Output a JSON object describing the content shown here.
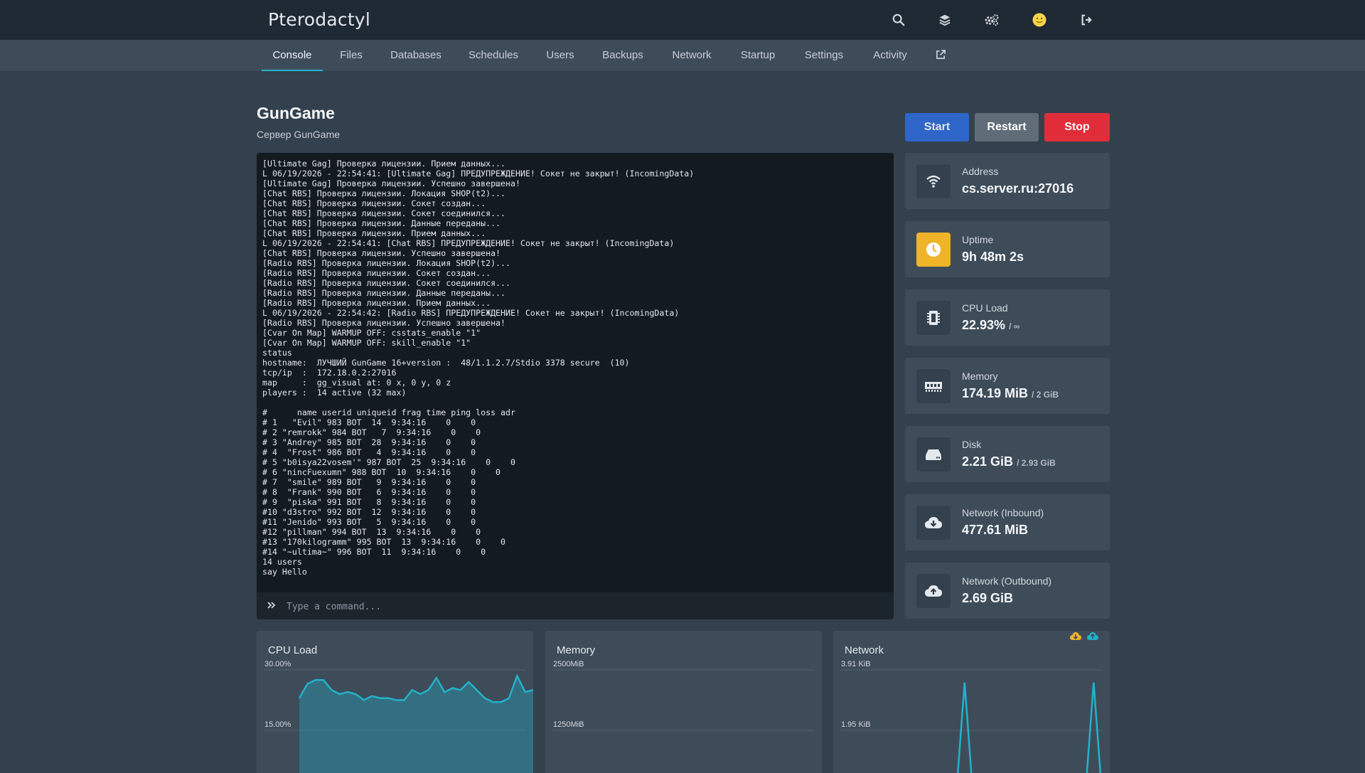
{
  "app": {
    "brand": "Pterodactyl"
  },
  "topbar": {
    "icons": [
      "search-icon",
      "layers-icon",
      "cogs-icon",
      "avatar",
      "sign-out-icon"
    ]
  },
  "tabs": [
    {
      "label": "Console",
      "active": true
    },
    {
      "label": "Files"
    },
    {
      "label": "Databases"
    },
    {
      "label": "Schedules"
    },
    {
      "label": "Users"
    },
    {
      "label": "Backups"
    },
    {
      "label": "Network"
    },
    {
      "label": "Startup"
    },
    {
      "label": "Settings"
    },
    {
      "label": "Activity"
    }
  ],
  "server": {
    "name": "GunGame",
    "description": "Сервер GunGame"
  },
  "power": {
    "start": "Start",
    "restart": "Restart",
    "stop": "Stop"
  },
  "console": {
    "lines": [
      "[Ultimate Gag] Проверка лицензии. Прием данных...",
      "L 06/19/2026 - 22:54:41: [Ultimate Gag] ПРЕДУПРЕЖДЕНИЕ! Сокет не закрыт! (IncomingData)",
      "[Ultimate Gag] Проверка лицензии. Успешно завершена!",
      "[Chat RBS] Проверка лицензии. Локация SHOP(t2)...",
      "[Chat RBS] Проверка лицензии. Сокет создан...",
      "[Chat RBS] Проверка лицензии. Сокет соединился...",
      "[Chat RBS] Проверка лицензии. Данные переданы...",
      "[Chat RBS] Проверка лицензии. Прием данных...",
      "L 06/19/2026 - 22:54:41: [Chat RBS] ПРЕДУПРЕЖДЕНИЕ! Сокет не закрыт! (IncomingData)",
      "[Chat RBS] Проверка лицензии. Успешно завершена!",
      "[Radio RBS] Проверка лицензии. Локация SHOP(t2)...",
      "[Radio RBS] Проверка лицензии. Сокет создан...",
      "[Radio RBS] Проверка лицензии. Сокет соединился...",
      "[Radio RBS] Проверка лицензии. Данные переданы...",
      "[Radio RBS] Проверка лицензии. Прием данных...",
      "L 06/19/2026 - 22:54:42: [Radio RBS] ПРЕДУПРЕЖДЕНИЕ! Сокет не закрыт! (IncomingData)",
      "[Radio RBS] Проверка лицензии. Успешно завершена!",
      "[Cvar On Map] WARMUP OFF: csstats_enable \"1\"",
      "[Cvar On Map] WARMUP OFF: skill_enable \"1\"",
      "status",
      "hostname:  ЛУЧШИЙ GunGame 16+version :  48/1.1.2.7/Stdio 3378 secure  (10)",
      "tcp/ip  :  172.18.0.2:27016",
      "map     :  gg_visual at: 0 x, 0 y, 0 z",
      "players :  14 active (32 max)",
      "",
      "#      name userid uniqueid frag time ping loss adr",
      "# 1   \"Evil\" 983 BOT  14  9:34:16    0    0",
      "# 2 \"remrokk\" 984 BOT   7  9:34:16    0    0",
      "# 3 \"Andrey\" 985 BOT  28  9:34:16    0    0",
      "# 4  \"Frost\" 986 BOT   4  9:34:16    0    0",
      "# 5 \"b0isya22vosem'\" 987 BOT  25  9:34:16    0    0",
      "# 6 \"nincFuexumn\" 988 BOT  10  9:34:16    0    0",
      "# 7  \"smile\" 989 BOT   9  9:34:16    0    0",
      "# 8  \"Frank\" 990 BOT   6  9:34:16    0    0",
      "# 9  \"piska\" 991 BOT   8  9:34:16    0    0",
      "#10 \"d3stro\" 992 BOT  12  9:34:16    0    0",
      "#11 \"Jenido\" 993 BOT   5  9:34:16    0    0",
      "#12 \"pillman\" 994 BOT  13  9:34:16    0    0",
      "#13 \"170kilogramm\" 995 BOT  13  9:34:16    0    0",
      "#14 \"~ultima~\" 996 BOT  11  9:34:16    0    0",
      "14 users",
      "say Hello"
    ],
    "command_placeholder": "Type a command..."
  },
  "stats": [
    {
      "label": "Address",
      "value": "cs.server.ru:27016",
      "sub": "",
      "icon": "wifi-icon"
    },
    {
      "label": "Uptime",
      "value": "9h 48m 2s",
      "sub": "",
      "icon": "clock-icon",
      "highlight": "#f0b429"
    },
    {
      "label": "CPU Load",
      "value": "22.93%",
      "sub": "/ ∞",
      "icon": "microchip-icon"
    },
    {
      "label": "Memory",
      "value": "174.19 MiB",
      "sub": "/ 2 GiB",
      "icon": "memory-icon"
    },
    {
      "label": "Disk",
      "value": "2.21 GiB",
      "sub": "/ 2.93 GiB",
      "icon": "hdd-icon"
    },
    {
      "label": "Network (Inbound)",
      "value": "477.61 MiB",
      "sub": "",
      "icon": "cloud-download-icon"
    },
    {
      "label": "Network (Outbound)",
      "value": "2.69 GiB",
      "sub": "",
      "icon": "cloud-upload-icon"
    }
  ],
  "colors": {
    "accent": "#22b2cb",
    "start": "#2d6cdf",
    "restart": "#606c78",
    "stop": "#e12d39",
    "inbound": "#f0b429",
    "outbound": "#22b2cb"
  },
  "chart_data": [
    {
      "type": "area",
      "title": "CPU Load",
      "y_ticks": [
        "30.00%",
        "15.00%"
      ],
      "ylim": [
        0,
        30
      ],
      "grid": true,
      "values": [
        23,
        26.5,
        27.5,
        27.5,
        25,
        24,
        24.5,
        24,
        22.5,
        23.5,
        23,
        23,
        22.5,
        22.5,
        25,
        24,
        25,
        28,
        24.5,
        25.5,
        25,
        27,
        25,
        23,
        22,
        22,
        23,
        28.5,
        24.5,
        25
      ]
    },
    {
      "type": "area",
      "title": "Memory",
      "y_ticks": [
        "2500MiB",
        "1250MiB"
      ],
      "ylim": [
        0,
        2500
      ],
      "grid": true,
      "values": []
    },
    {
      "type": "line",
      "title": "Network",
      "y_ticks": [
        "3.91 KiB",
        "1.95 KiB"
      ],
      "ylim": [
        0,
        3.91
      ],
      "grid": true,
      "legend": "top-right",
      "series": [
        {
          "values": [
            0,
            0,
            0,
            0,
            0,
            0,
            0,
            0,
            0,
            0,
            0,
            0,
            0,
            0,
            0,
            0,
            0,
            0,
            0,
            0,
            0,
            0,
            0,
            0,
            0,
            0,
            0,
            0,
            0,
            0
          ]
        },
        {
          "values": [
            0,
            0,
            0,
            0,
            0,
            0,
            0,
            0,
            0,
            0,
            0,
            3.5,
            0,
            0,
            0,
            0,
            0,
            0,
            0,
            0,
            0,
            0,
            0,
            0,
            0,
            0,
            0,
            3.5,
            0,
            0
          ]
        }
      ]
    }
  ]
}
